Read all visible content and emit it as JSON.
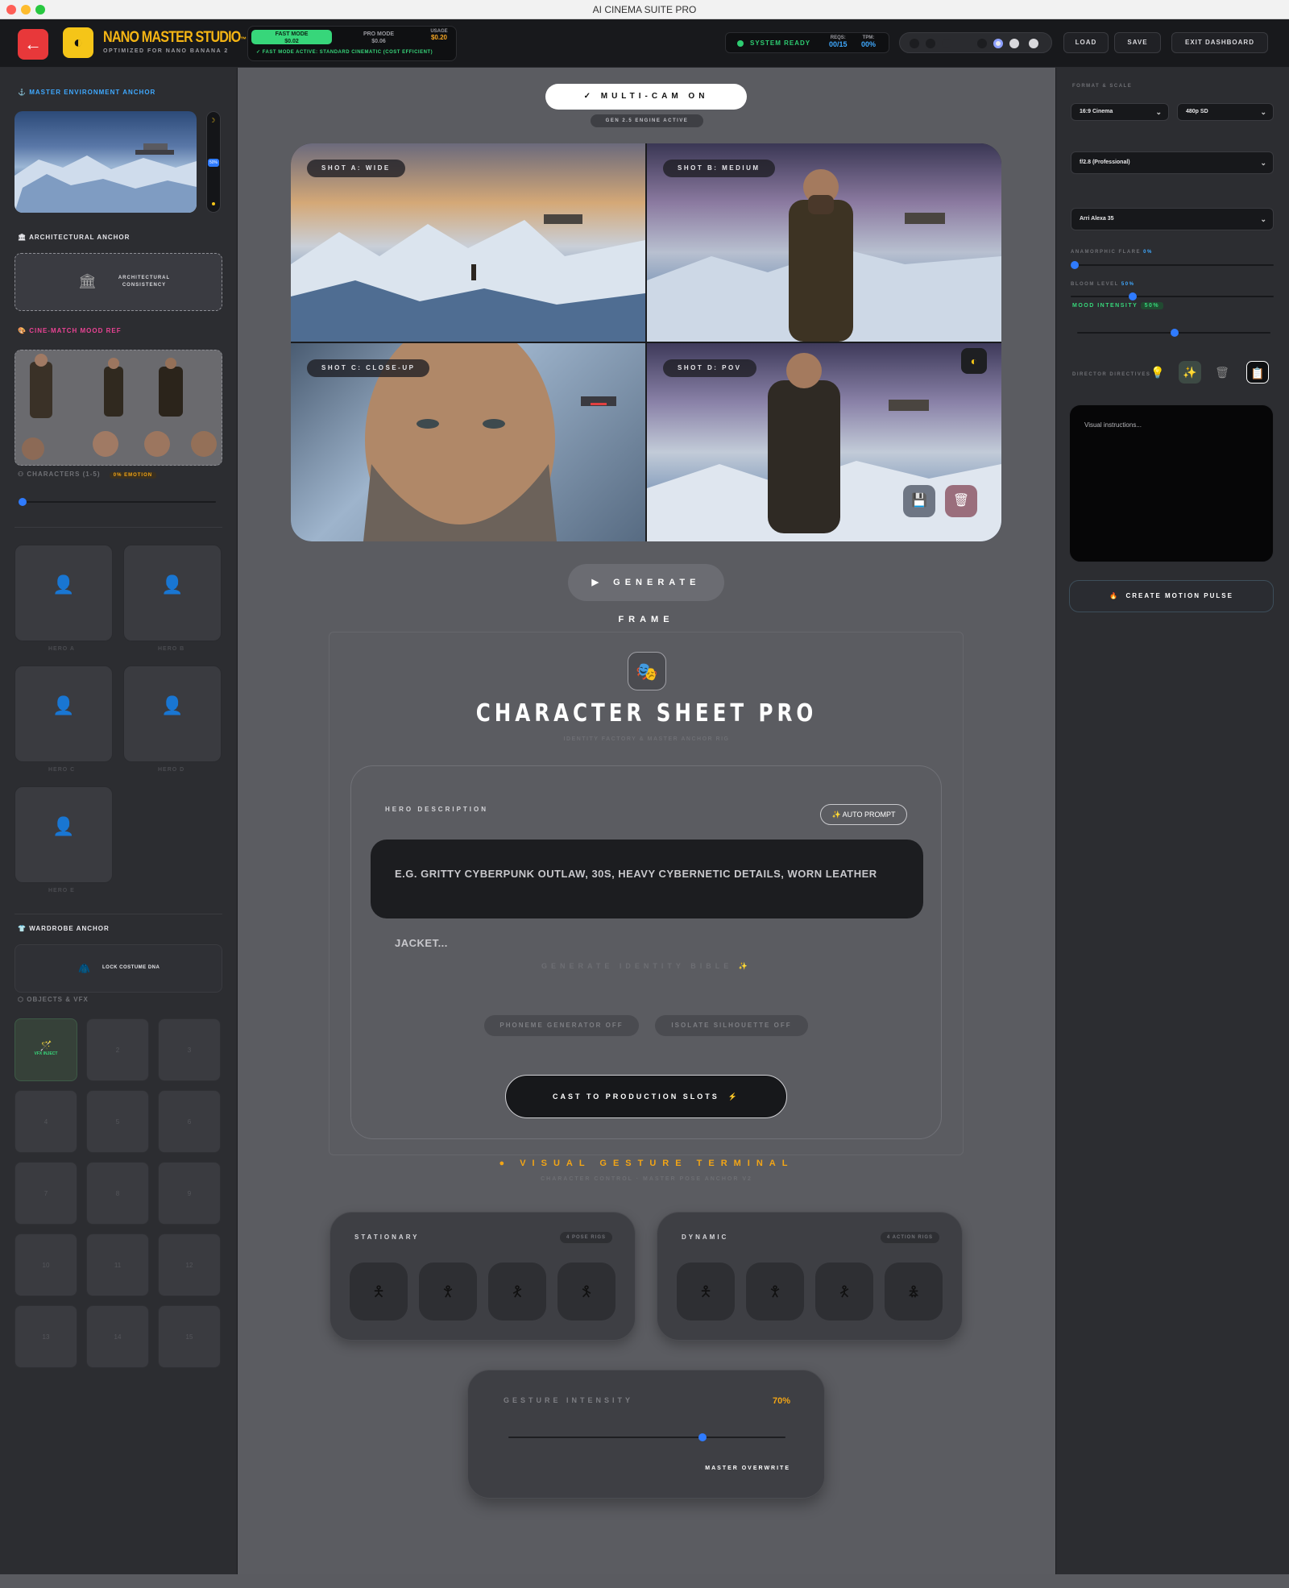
{
  "window": {
    "title": "AI CINEMA SUITE PRO"
  },
  "header": {
    "back_icon": "arrow-left-icon",
    "brand": "NANO MASTER STUDIO",
    "brand_suffix": "™",
    "brand_sub": "OPTIMIZED FOR NANO BANANA 2",
    "fast_mode": {
      "label": "FAST MODE",
      "price": "$0.02"
    },
    "pro_mode": {
      "label": "PRO MODE",
      "price": "$0.06"
    },
    "usage": {
      "label": "USAGE",
      "value": "$0.20"
    },
    "fast_note": "✓ FAST MODE ACTIVE: STANDARD CINEMATIC (COST EFFICIENT)",
    "status": "SYSTEM READY",
    "reqs": {
      "label": "REQS:",
      "value": "00/15"
    },
    "tpm": {
      "label": "TPM:",
      "value": "00%"
    },
    "load": "LOAD",
    "save": "SAVE",
    "exit": "EXIT DASHBOARD"
  },
  "left": {
    "env_anchor": "MASTER ENVIRONMENT ANCHOR",
    "env_slider_value": "50%",
    "arch_anchor": "ARCHITECTURAL ANCHOR",
    "arch_box": "ARCHITECTURAL CONSISTENCY",
    "mood_ref": "CINE-MATCH MOOD REF",
    "characters": "CHARACTERS (1-5)",
    "emotion_badge": "0% EMOTION",
    "heroes": [
      "HERO A",
      "HERO B",
      "HERO C",
      "HERO D",
      "HERO E"
    ],
    "wardrobe": "WARDROBE ANCHOR",
    "lock_costume": "LOCK COSTUME DNA",
    "objects": "OBJECTS & VFX",
    "vfx_inject": "VFX INJECT",
    "object_slots": [
      "2",
      "3",
      "4",
      "5",
      "6",
      "7",
      "8",
      "9",
      "10",
      "11",
      "12",
      "13",
      "14",
      "15"
    ]
  },
  "main": {
    "multicam": "✓ MULTI-CAM ON",
    "engine": "GEN 2.5 ENGINE ACTIVE",
    "shots": [
      "SHOT A: WIDE",
      "SHOT B: MEDIUM",
      "SHOT C: CLOSE-UP",
      "SHOT D: POV"
    ],
    "generate_frame": "GENERATE FRAME",
    "cs_title": "CHARACTER SHEET PRO",
    "cs_sub": "IDENTITY FACTORY & MASTER ANCHOR RIG",
    "hero_desc_label": "HERO DESCRIPTION",
    "auto_prompt": "✨ AUTO PROMPT",
    "hero_desc_placeholder": "E.G. GRITTY CYBERPUNK OUTLAW, 30S, HEAVY CYBERNETIC DETAILS, WORN LEATHER JACKET...",
    "gen_bible": "GENERATE IDENTITY BIBLE",
    "phoneme": "PHONEME GENERATOR OFF",
    "isolate": "ISOLATE SILHOUETTE OFF",
    "cast_btn": "CAST TO PRODUCTION SLOTS",
    "vgt_title": "VISUAL GESTURE TERMINAL",
    "vgt_sub": "CHARACTER CONTROL · MASTER POSE ANCHOR V2",
    "stationary": "STATIONARY",
    "stationary_badge": "4 POSE RIGS",
    "dynamic": "DYNAMIC",
    "dynamic_badge": "4 ACTION RIGS",
    "gesture_intensity": "GESTURE INTENSITY",
    "gesture_value": "70%",
    "gesture_value_num": 70,
    "master_overwrite": "MASTER OVERWRITE"
  },
  "right": {
    "format_scale": "FORMAT & SCALE",
    "aspect": "16:9 Cinema",
    "resolution": "480p SD",
    "aperture": "f/2.8 (Professional)",
    "camera": "Arri Alexa 35",
    "anamorphic": "ANAMORPHIC FLARE",
    "anamorphic_value": "0%",
    "bloom": "BLOOM LEVEL",
    "bloom_value": "50%",
    "mood": "MOOD INTENSITY",
    "mood_value": "50%",
    "directives": "DIRECTOR DIRECTIVES",
    "visual_placeholder": "Visual instructions...",
    "motion_pulse": "CREATE MOTION PULSE"
  },
  "colors": {
    "accent_yellow": "#f5b514",
    "accent_green": "#37d67a",
    "accent_blue": "#2f7bff",
    "accent_orange": "#f2a516",
    "danger": "#e8383a"
  }
}
